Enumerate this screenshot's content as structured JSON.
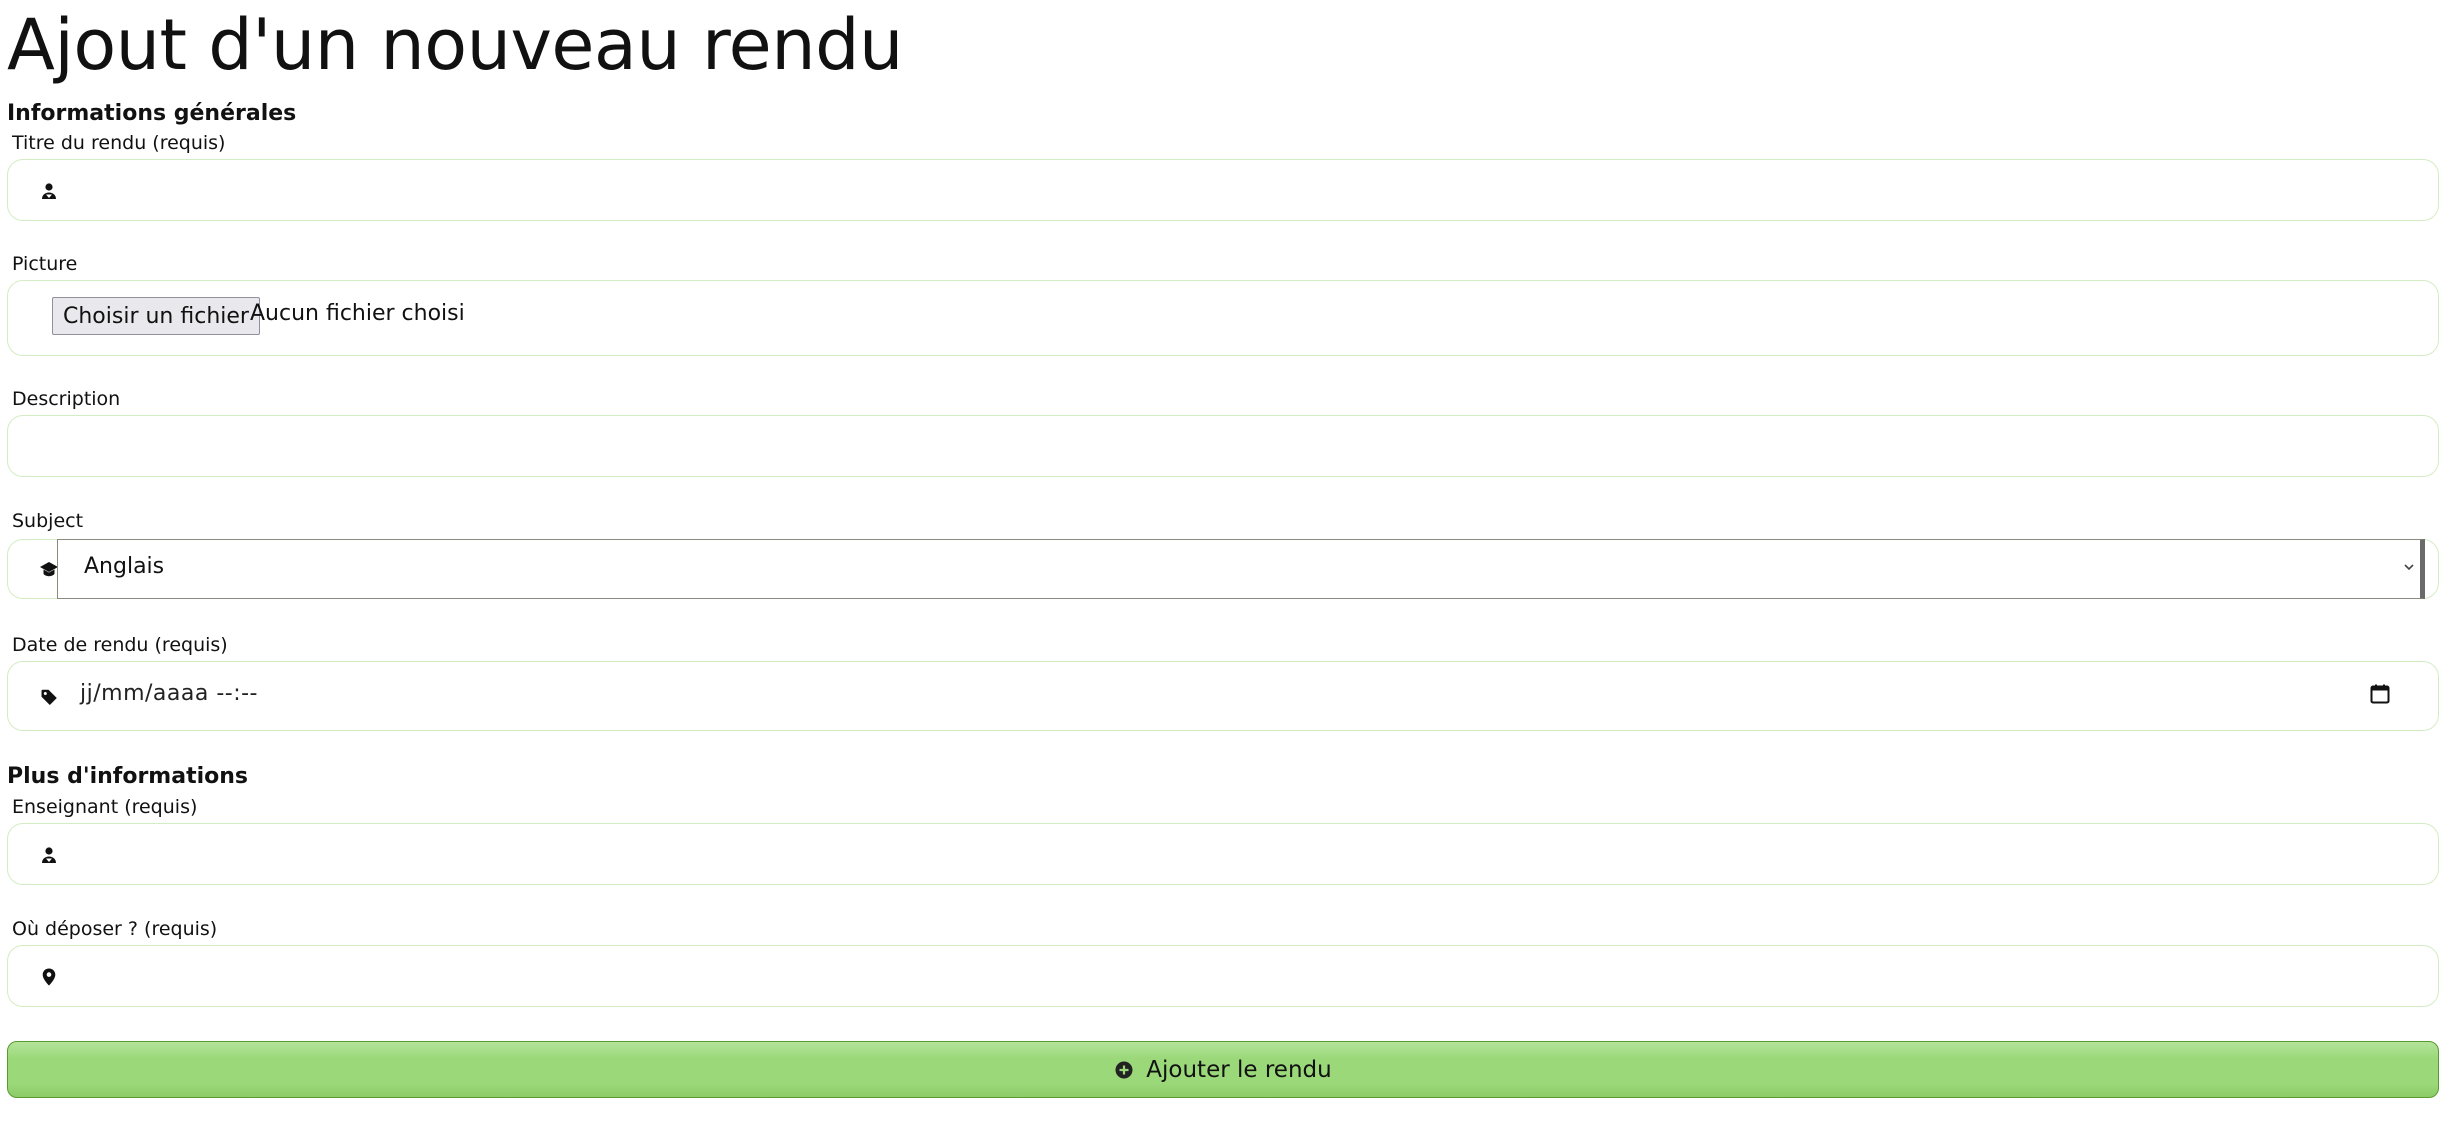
{
  "page": {
    "title": "Ajout d'un nouveau rendu"
  },
  "sections": {
    "general": "Informations générales",
    "more": "Plus d'informations"
  },
  "fields": {
    "title": {
      "label": "Titre du rendu (requis)",
      "value": "",
      "icon": "person-icon"
    },
    "picture": {
      "label": "Picture",
      "button_label": "Choisir un fichier",
      "status": "Aucun fichier choisi"
    },
    "description": {
      "label": "Description",
      "value": ""
    },
    "subject": {
      "label": "Subject",
      "selected": "Anglais",
      "icon": "graduation-cap-icon"
    },
    "due_date": {
      "label": "Date de rendu (requis)",
      "placeholder": "jj/mm/aaaa  --:--",
      "icon": "tag-icon"
    },
    "teacher": {
      "label": "Enseignant (requis)",
      "value": "",
      "icon": "person-icon"
    },
    "location": {
      "label": "Où déposer ? (requis)",
      "value": "",
      "icon": "location-pin-icon"
    }
  },
  "submit": {
    "label": "Ajouter le rendu",
    "icon": "plus-circle-icon"
  },
  "colors": {
    "field_border": "#d4ecc4",
    "button_fill": "#9bd879",
    "button_border": "#5a9a2e"
  }
}
